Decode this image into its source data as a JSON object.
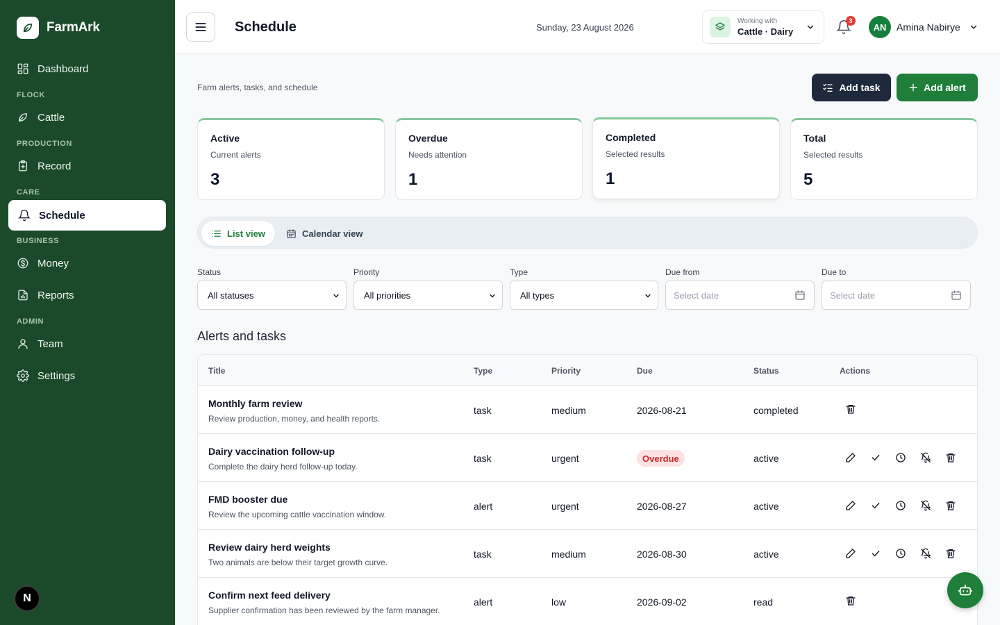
{
  "app": {
    "name": "FarmArk"
  },
  "sidebar": {
    "items": [
      {
        "label": "Dashboard",
        "icon": "grid-icon"
      },
      {
        "section": "FLOCK"
      },
      {
        "label": "Cattle",
        "icon": "leaf-icon"
      },
      {
        "section": "PRODUCTION"
      },
      {
        "label": "Record",
        "icon": "clipboard-plus-icon"
      },
      {
        "section": "CARE"
      },
      {
        "label": "Schedule",
        "icon": "bell-icon",
        "active": true
      },
      {
        "section": "BUSINESS"
      },
      {
        "label": "Money",
        "icon": "dollar-circle-icon"
      },
      {
        "label": "Reports",
        "icon": "file-chart-icon"
      },
      {
        "section": "ADMIN"
      },
      {
        "label": "Team",
        "icon": "user-icon"
      },
      {
        "label": "Settings",
        "icon": "gear-icon"
      }
    ],
    "badge": "N"
  },
  "header": {
    "title": "Schedule",
    "date": "Sunday, 23 August 2026",
    "context": {
      "small": "Working with",
      "main": "Cattle · Dairy"
    },
    "notifications": "3",
    "user": {
      "initials": "AN",
      "name": "Amina Nabirye"
    }
  },
  "main": {
    "subtitle": "Farm alerts, tasks, and schedule",
    "add_task": "Add task",
    "add_alert": "Add alert",
    "stats": [
      {
        "title": "Active",
        "sub": "Current alerts",
        "value": "3"
      },
      {
        "title": "Overdue",
        "sub": "Needs attention",
        "value": "1"
      },
      {
        "title": "Completed",
        "sub": "Selected results",
        "value": "1"
      },
      {
        "title": "Total",
        "sub": "Selected results",
        "value": "5"
      }
    ],
    "views": {
      "list": "List view",
      "calendar": "Calendar view"
    },
    "filters": {
      "status": {
        "label": "Status",
        "value": "All statuses"
      },
      "priority": {
        "label": "Priority",
        "value": "All priorities"
      },
      "type": {
        "label": "Type",
        "value": "All types"
      },
      "due_from": {
        "label": "Due from",
        "placeholder": "Select date"
      },
      "due_to": {
        "label": "Due to",
        "placeholder": "Select date"
      }
    },
    "section_title": "Alerts and tasks",
    "table": {
      "headers": [
        "Title",
        "Type",
        "Priority",
        "Due",
        "Status",
        "Actions"
      ],
      "rows": [
        {
          "title": "Monthly farm review",
          "desc": "Review production, money, and health reports.",
          "type": "task",
          "priority": "medium",
          "due": "2026-08-21",
          "status": "completed"
        },
        {
          "title": "Dairy vaccination follow-up",
          "desc": "Complete the dairy herd follow-up today.",
          "type": "task",
          "priority": "urgent",
          "due": "Overdue",
          "status": "active"
        },
        {
          "title": "FMD booster due",
          "desc": "Review the upcoming cattle vaccination window.",
          "type": "alert",
          "priority": "urgent",
          "due": "2026-08-27",
          "status": "active"
        },
        {
          "title": "Review dairy herd weights",
          "desc": "Two animals are below their target growth curve.",
          "type": "task",
          "priority": "medium",
          "due": "2026-08-30",
          "status": "active"
        },
        {
          "title": "Confirm next feed delivery",
          "desc": "Supplier confirmation has been reviewed by the farm manager.",
          "type": "alert",
          "priority": "low",
          "due": "2026-09-02",
          "status": "read"
        }
      ]
    }
  }
}
